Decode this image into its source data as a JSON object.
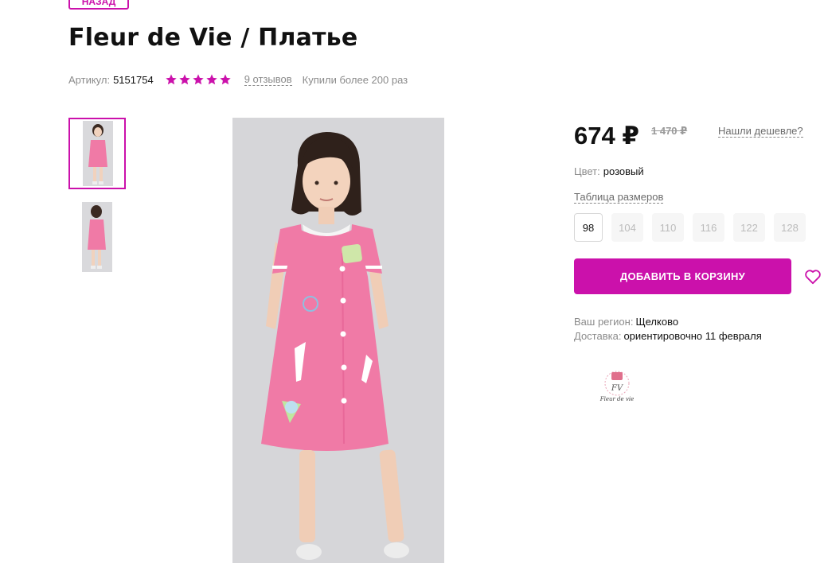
{
  "nav": {
    "back_label": "НАЗАД"
  },
  "product": {
    "title": "Fleur de Vie / Платье",
    "article_label": "Артикул:",
    "article_value": "5151754",
    "rating_stars": 5,
    "reviews_label": "9 отзывов",
    "bought_label": "Купили более 200 раз"
  },
  "gallery": {
    "thumbnails": [
      "thumbnail-front",
      "thumbnail-side"
    ],
    "selected_index": 0
  },
  "price": {
    "current": "674 ₽",
    "old": "1 470 ₽",
    "cheaper_link": "Нашли дешевле?"
  },
  "color": {
    "label": "Цвет:",
    "value": "розовый"
  },
  "size_table_link": "Таблица размеров",
  "sizes": [
    "98",
    "104",
    "110",
    "116",
    "122",
    "128"
  ],
  "selected_size": "98",
  "cart_button": "ДОБАВИТЬ В КОРЗИНУ",
  "region": {
    "label": "Ваш регион:",
    "value": "Щелково"
  },
  "delivery": {
    "label": "Доставка:",
    "value": "ориентировочно 11 февраля"
  },
  "brand_logo_text": "Fleur de vie",
  "colors": {
    "accent": "#cb11ab",
    "star": "#cb11ab",
    "dress": "#f07aa6"
  }
}
